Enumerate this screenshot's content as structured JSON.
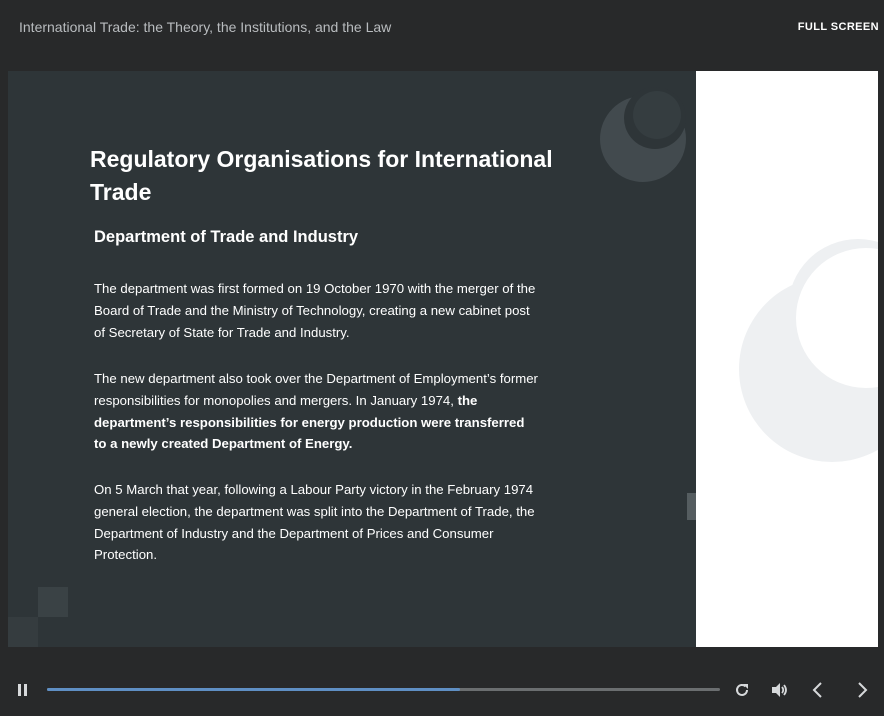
{
  "header": {
    "course_title": "International Trade: the Theory, the Institutions, and the Law",
    "fullscreen_label": "FULL SCREEN"
  },
  "slide": {
    "title": "Regulatory Organisations for International Trade",
    "heading": "Department of Trade and Industry",
    "paragraph1": "The department was first formed on 19 October 1970 with the merger of the Board of Trade and the Ministry of Technology, creating a new cabinet post of Secretary of State for Trade and Industry.",
    "paragraph2_plain": "The new department also took over the Department of Employment’s former responsibilities for monopolies and mergers. In January 1974, ",
    "paragraph2_bold": "the department’s responsibilities for energy production were transferred to a newly created Department of Energy.",
    "paragraph3": "On 5 March that year, following a Labour Party victory in the February 1974 general election, the department was split into the Department of Trade, the Department of Industry and the Department of Prices and Consumer Protection."
  },
  "player": {
    "progress_fraction": 0.613,
    "icons": [
      "pause-icon",
      "replay-icon",
      "volume-icon",
      "chevron-left-icon",
      "chevron-right-icon"
    ],
    "colors": {
      "progress_fill": "#5f8fc4",
      "slide_background": "#2e3538",
      "app_background": "#28292a"
    }
  }
}
